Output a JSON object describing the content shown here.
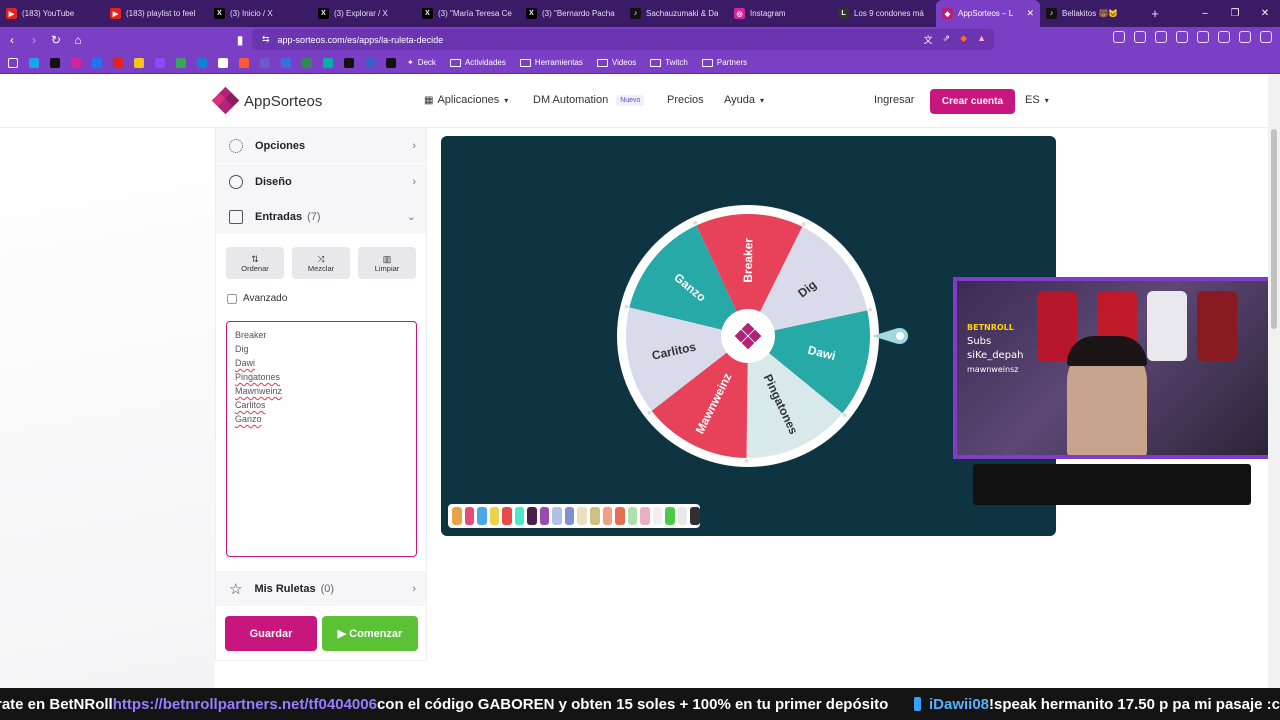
{
  "browser": {
    "tabs": [
      {
        "title": "(183) YouTube",
        "color": "#e62117",
        "glyph": "▶"
      },
      {
        "title": "(183) playlist to feel",
        "color": "#e62117",
        "glyph": "▶"
      },
      {
        "title": "(3) Inicio / X",
        "color": "#000000",
        "glyph": "X"
      },
      {
        "title": "(3) Explorar / X",
        "color": "#000000",
        "glyph": "X"
      },
      {
        "title": "(3) \"María Teresa Ce",
        "color": "#000000",
        "glyph": "X"
      },
      {
        "title": "(3) \"Bernardo Pacha",
        "color": "#000000",
        "glyph": "X"
      },
      {
        "title": "Sachauzumaki & Da",
        "color": "#111111",
        "glyph": "♪"
      },
      {
        "title": "Instagram",
        "color": "#d6249f",
        "glyph": "◎"
      },
      {
        "title": "Los 9 condones má",
        "color": "#333333",
        "glyph": "L"
      },
      {
        "title": "AppSorteos – L",
        "color": "#b02377",
        "glyph": "◆"
      },
      {
        "title": "Bellakitos 🐻🐱",
        "color": "#111111",
        "glyph": "♪"
      }
    ],
    "active_tab_index": 9,
    "new_tab_symbol": "+",
    "window_controls": [
      "–",
      "❐",
      "✕"
    ],
    "url": "app-sorteos.com/es/apps/la-ruleta-decide",
    "bookmarks": [
      "Deck",
      "Actividades",
      "Herramientas",
      "Videos",
      "Twitch",
      "Partners"
    ]
  },
  "header": {
    "logo_text": "AppSorteos",
    "nav": {
      "apps": "Aplicaciones",
      "dm": "DM Automation",
      "dm_badge": "Nuevo",
      "prices": "Precios",
      "help": "Ayuda"
    },
    "login": "Ingresar",
    "signup": "Crear cuenta",
    "lang": "ES"
  },
  "panel": {
    "options": "Opciones",
    "design": "Diseño",
    "entries_title": "Entradas",
    "entries_count": "(7)",
    "tools": {
      "sort": "Ordenar",
      "shuffle": "Mezclar",
      "clear": "Limpiar"
    },
    "advanced": "Avanzado",
    "entries": [
      "Breaker",
      "Dig",
      "Dawi",
      "Pingatones",
      "Mawnweinz",
      "Carlitos",
      "Ganzo"
    ],
    "my_wheels": "Mis Ruletas",
    "my_wheels_count": "(0)",
    "save": "Guardar",
    "start": "▶ Comenzar"
  },
  "wheel": {
    "segments": [
      {
        "label": "Breaker",
        "color": "#e8415a"
      },
      {
        "label": "Dig",
        "color": "#d9dbea"
      },
      {
        "label": "Dawi",
        "color": "#27a9a8"
      },
      {
        "label": "Pingatones",
        "color": "#d9e8ea"
      },
      {
        "label": "Mawnweinz",
        "color": "#e8415a"
      },
      {
        "label": "Carlitos",
        "color": "#d9dbea"
      },
      {
        "label": "Ganzo",
        "color": "#27a9a8"
      }
    ],
    "center_color": "#b02377",
    "stage_color": "#0e3442"
  },
  "palette": [
    "#e8a24a",
    "#e84a7a",
    "#4aa8e8",
    "#e8d44a",
    "#e84a4a",
    "#4ae8c8",
    "#4a1e4a",
    "#9a4ab0",
    "#b0c0e8",
    "#8090d0",
    "#e8e0c0",
    "#d0c080",
    "#f0a080",
    "#e07050",
    "#b0e0b0",
    "#e8b0c0",
    "#f0f0f0",
    "#4acc4a",
    "#e8e8e8",
    "#303030"
  ],
  "cam": {
    "lines": [
      "BETNROLL",
      "Subs",
      "siKe_depah",
      "mawnweinsz"
    ]
  },
  "ticker": {
    "t1": "rate en BetNRoll ",
    "link": "https://betnrollpartners.net/tf0404006",
    "t2": " con el código GABOREN y obten 15 soles + 100% en tu primer depósito",
    "user": "iDawii08",
    "msg": " !speak hermanito 17.50 p pa mi pasaje :c"
  }
}
